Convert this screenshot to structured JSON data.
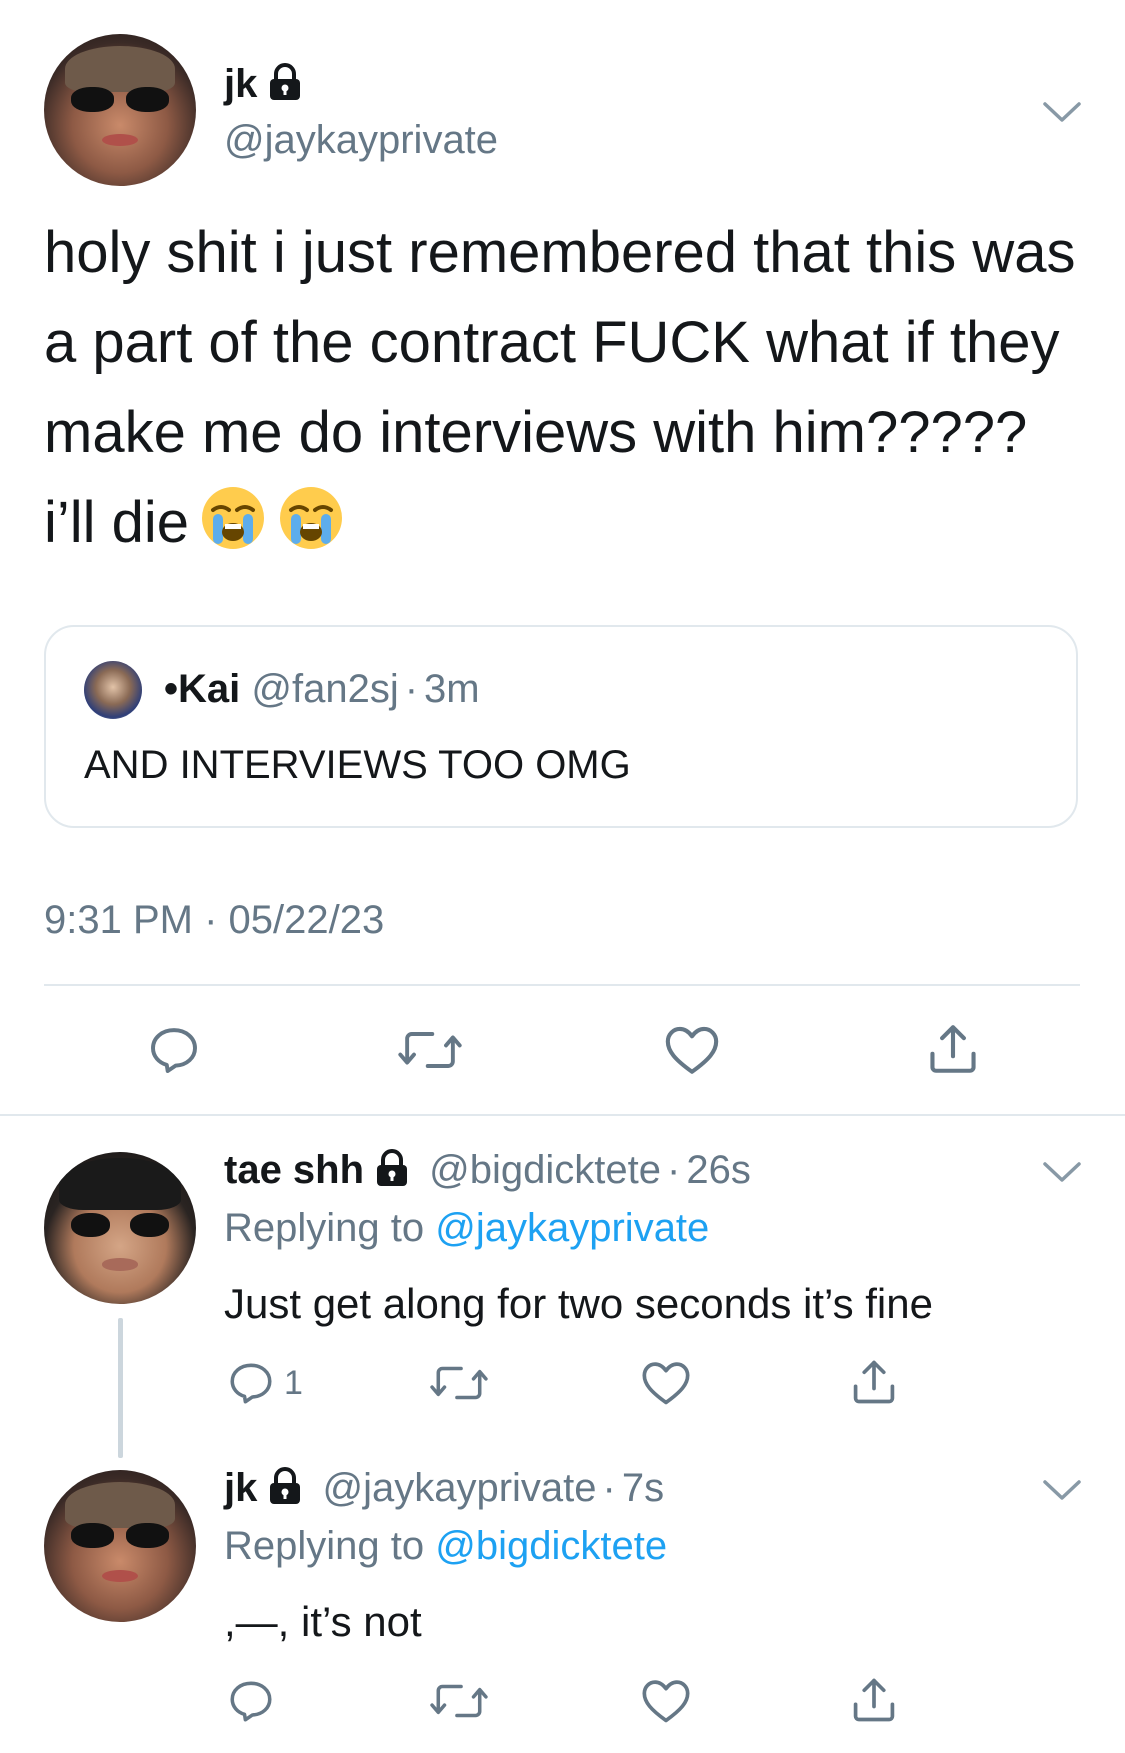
{
  "main_tweet": {
    "display_name": "jk",
    "handle": "@jaykayprivate",
    "text": "holy shit i just remembered that this was a part of the contract FUCK what if they make me do interviews with him????? i’ll die",
    "emoji": "loudly-crying-face",
    "timestamp": "9:31 PM · 05/22/23"
  },
  "quoted_tweet": {
    "display_name": "•Kai",
    "handle": "@fan2sj",
    "time": "3m",
    "text": "AND INTERVIEWS TOO OMG"
  },
  "replies": [
    {
      "display_name": "tae shh",
      "handle": "@bigdicktete",
      "time": "26s",
      "replying_prefix": "Replying to",
      "replying_to": "@jaykayprivate",
      "text": "Just get along for two seconds it’s fine",
      "reply_count": "1"
    },
    {
      "display_name": "jk",
      "handle": "@jaykayprivate",
      "time": "7s",
      "replying_prefix": "Replying to",
      "replying_to": "@bigdicktete",
      "text": ",—, it’s not"
    }
  ],
  "separator": "·",
  "colors": {
    "text": "#14171a",
    "secondary": "#657786",
    "link": "#1da1f2",
    "border": "#e1e8ed",
    "icon": "#657786"
  }
}
